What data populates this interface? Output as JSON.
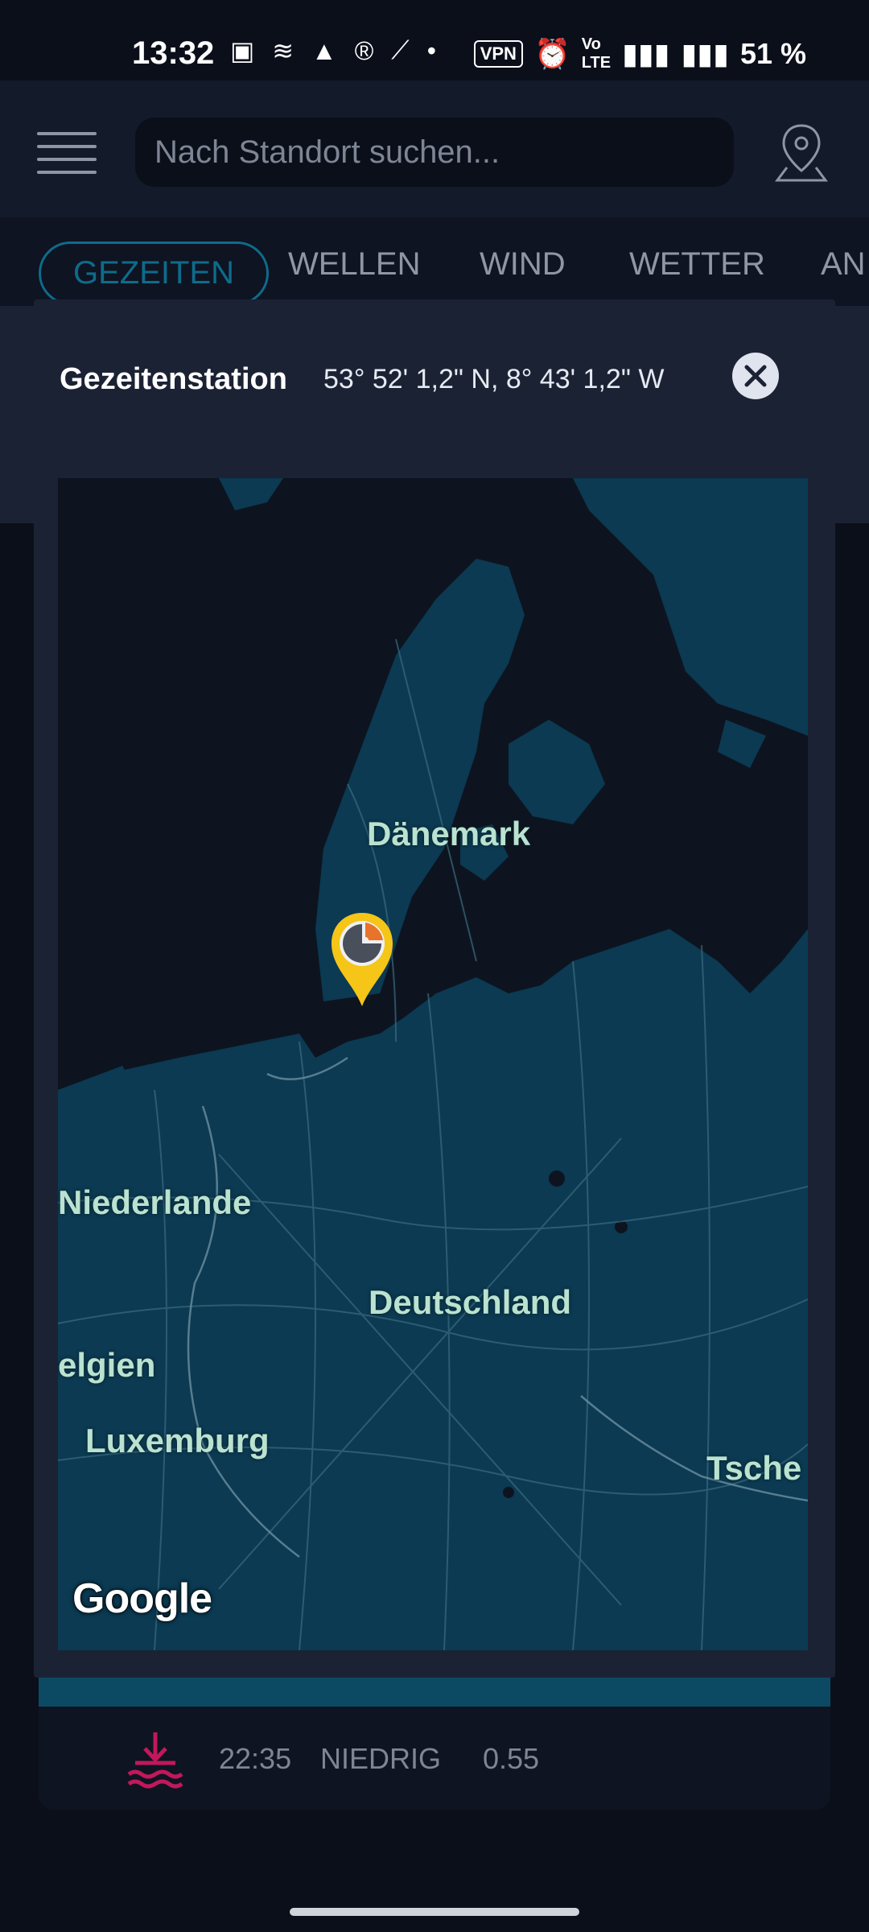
{
  "status_bar": {
    "time": "13:32",
    "vpn": "VPN",
    "battery": "51 %"
  },
  "app_bar": {
    "search_placeholder": "Nach Standort suchen..."
  },
  "tabs": [
    {
      "label": "GEZEITEN",
      "active": true
    },
    {
      "label": "WELLEN"
    },
    {
      "label": "WIND"
    },
    {
      "label": "WETTER"
    },
    {
      "label": "AN"
    }
  ],
  "modal": {
    "title": "Gezeitenstation",
    "coords": "53° 52' 1,2\" N, 8° 43' 1,2\" W"
  },
  "map": {
    "labels": {
      "denmark": "Dänemark",
      "netherlands": "Niederlande",
      "germany": "Deutschland",
      "belgium": "elgien",
      "luxembourg": "Luxemburg",
      "czech": "Tsche"
    },
    "attribution": "Google"
  },
  "tide_row": {
    "time": "22:35",
    "level": "NIEDRIG",
    "value": "0.55"
  },
  "colors": {
    "land": "#0b3a52",
    "water": "#0d1420",
    "pin": "#f5c518",
    "accent": "#0e6b8c"
  }
}
